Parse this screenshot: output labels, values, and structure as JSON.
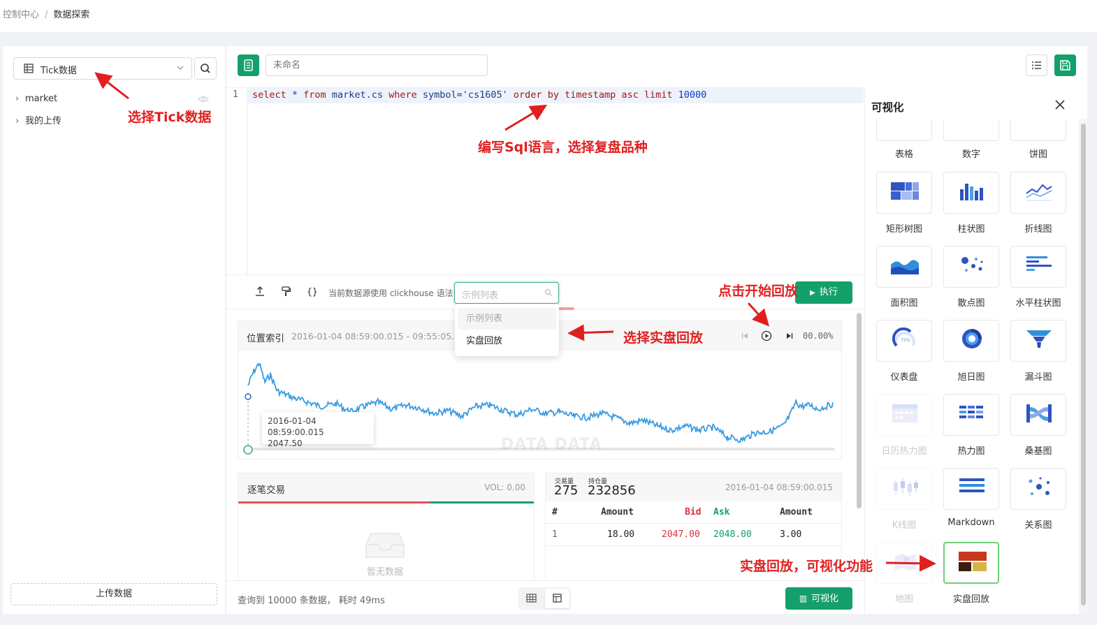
{
  "breadcrumb": {
    "root": "控制中心",
    "current": "数据探索"
  },
  "sidebar": {
    "datasource": "Tick数据",
    "tree": [
      "market",
      "我的上传"
    ],
    "upload_label": "上传数据"
  },
  "query": {
    "name_placeholder": "未命名",
    "line_number": "1",
    "sql": {
      "t1": "select",
      "t2": " * ",
      "t3": "from",
      "t4": " market.cs ",
      "t5": "where",
      "t6": " symbol=",
      "t7": "'cs1605'",
      "t8": " order by timestamp asc limit ",
      "t9": "10000"
    }
  },
  "toolbar": {
    "syntax_hint": "当前数据源使用 clickhouse 语法",
    "example_placeholder": "示例列表",
    "run_label": "执行"
  },
  "dropdown": {
    "options": [
      "示例列表",
      "实盘回放"
    ]
  },
  "replay_chart": {
    "title": "位置索引",
    "range": "2016-01-04 08:59:00.015 - 09:55:05.773",
    "progress": "00.00%",
    "tooltip_time": "2016-01-04 08:59:00.015",
    "tooltip_value": "2047.50",
    "watermark": "DATA DATA"
  },
  "trade_panel": {
    "title": "逐笔交易",
    "vol": "VOL: 0.00",
    "empty": "暂无数据"
  },
  "order_book": {
    "volume_label": "交易量",
    "volume": "275",
    "open_interest_label": "持仓量",
    "open_interest": "232856",
    "time": "2016-01-04 08:59:00.015",
    "columns": [
      "#",
      "Amount",
      "Bid",
      "Ask",
      "Amount"
    ],
    "row": [
      "1",
      "18.00",
      "2047.00",
      "2048.00",
      "3.00"
    ]
  },
  "footer": {
    "result": "查询到 10000 条数据， 耗时 49ms",
    "viz_label": "可视化"
  },
  "viz_panel": {
    "title": "可视化",
    "top_labels": [
      "表格",
      "数字",
      "饼图"
    ],
    "tiles": [
      {
        "label": "矩形树图",
        "icon": "treemap-icon"
      },
      {
        "label": "柱状图",
        "icon": "bar-chart-icon"
      },
      {
        "label": "折线图",
        "icon": "line-chart-icon"
      },
      {
        "label": "面积图",
        "icon": "area-chart-icon"
      },
      {
        "label": "散点图",
        "icon": "scatter-icon"
      },
      {
        "label": "水平柱状图",
        "icon": "hbar-icon"
      },
      {
        "label": "仪表盘",
        "icon": "gauge-icon"
      },
      {
        "label": "旭日图",
        "icon": "sunburst-icon"
      },
      {
        "label": "漏斗图",
        "icon": "funnel-icon"
      },
      {
        "label": "日历热力图",
        "icon": "calendar-heatmap-icon"
      },
      {
        "label": "热力图",
        "icon": "heatmap-icon"
      },
      {
        "label": "桑基图",
        "icon": "sankey-icon"
      },
      {
        "label": "K线图",
        "icon": "candlestick-icon"
      },
      {
        "label": "Markdown",
        "icon": "markdown-icon"
      },
      {
        "label": "关系图",
        "icon": "graph-icon"
      },
      {
        "label": "地图",
        "icon": "map-icon"
      },
      {
        "label": "实盘回放",
        "icon": "replay-icon"
      }
    ]
  },
  "annotations": {
    "a1": "选择Tick数据",
    "a2": "编写Sql语言，选择复盘品种",
    "a3": "点击开始回放",
    "a4": "选择实盘回放",
    "a5": "实盘回放，可视化功能"
  },
  "colors": {
    "accent": "#13a06a",
    "annotation": "#e02020",
    "line": "#3a9be0"
  }
}
